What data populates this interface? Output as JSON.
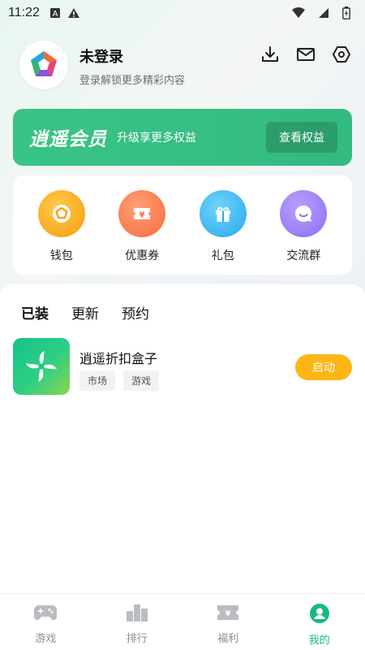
{
  "status_bar": {
    "time": "11:22"
  },
  "profile": {
    "name": "未登录",
    "subtitle": "登录解锁更多精彩内容",
    "actions": [
      "download-icon",
      "mail-icon",
      "settings-icon"
    ]
  },
  "vip": {
    "title": "逍遥会员",
    "subtitle": "升级享更多权益",
    "button": "查看权益"
  },
  "quick_links": [
    {
      "label": "钱包",
      "icon": "wallet-icon",
      "color": "#f9a11b"
    },
    {
      "label": "优惠券",
      "icon": "coupon-icon",
      "color": "#f9774a"
    },
    {
      "label": "礼包",
      "icon": "gift-icon",
      "color": "#3ab6ec"
    },
    {
      "label": "交流群",
      "icon": "chat-icon",
      "color": "#9a7cf2"
    }
  ],
  "tabs": [
    {
      "label": "已装",
      "active": true
    },
    {
      "label": "更新",
      "active": false
    },
    {
      "label": "预约",
      "active": false
    }
  ],
  "installed_apps": [
    {
      "name": "逍遥折扣盒子",
      "tags": [
        "市场",
        "游戏"
      ],
      "action": "启动"
    }
  ],
  "bottom_nav": [
    {
      "label": "游戏",
      "icon": "gamepad-icon",
      "active": false
    },
    {
      "label": "排行",
      "icon": "ranking-icon",
      "active": false
    },
    {
      "label": "福利",
      "icon": "ticket-icon",
      "active": false
    },
    {
      "label": "我的",
      "icon": "profile-icon",
      "active": true
    }
  ],
  "colors": {
    "brand_green": "#34b980",
    "accent_yellow": "#fdb615",
    "nav_active": "#17b97f"
  }
}
